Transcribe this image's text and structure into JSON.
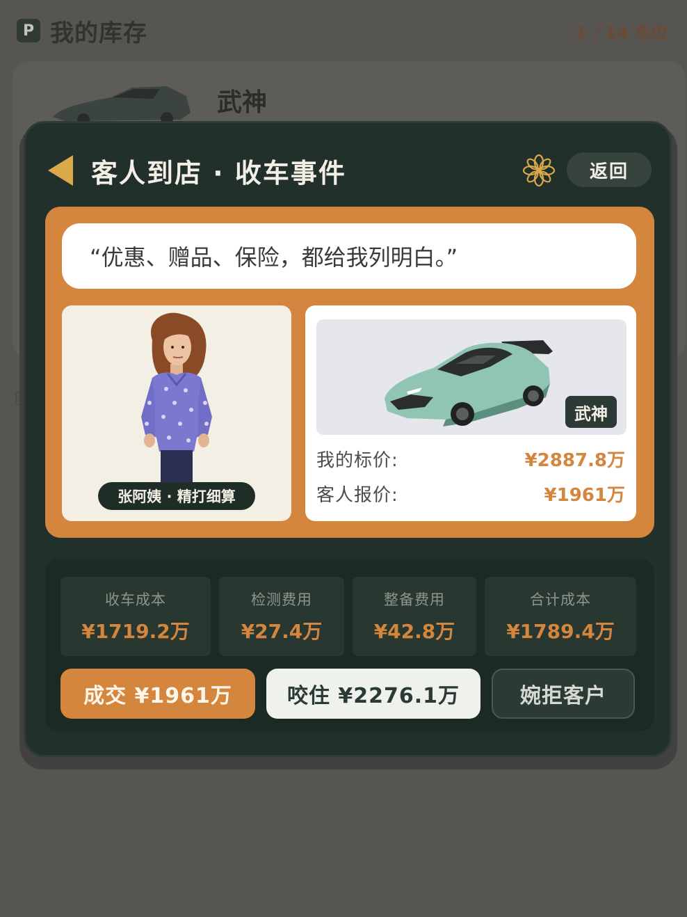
{
  "background": {
    "page_badge": "P",
    "page_title": "我的库存",
    "slots": "1 / 14 车位",
    "car_name": "武神",
    "side_text": "压"
  },
  "modal": {
    "title": "客人到店 · 收车事件",
    "return_label": "返回",
    "quote": "“优惠、赠品、保险，都给我列明白。”",
    "customer": {
      "tag": "张阿姨 · 精打细算"
    },
    "car": {
      "badge": "武神",
      "my_price_label": "我的标价:",
      "my_price_value": "¥2887.8万",
      "customer_offer_label": "客人报价:",
      "customer_offer_value": "¥1961万"
    },
    "costs": [
      {
        "label": "收车成本",
        "value": "¥1719.2万"
      },
      {
        "label": "检测费用",
        "value": "¥27.4万"
      },
      {
        "label": "整备费用",
        "value": "¥42.8万"
      },
      {
        "label": "合计成本",
        "value": "¥1789.4万"
      }
    ],
    "actions": {
      "deal": "成交 ¥1961万",
      "counter": "咬住 ¥2276.1万",
      "reject": "婉拒客户"
    }
  },
  "colors": {
    "accent": "#d4853e",
    "panel_dark": "#21302a",
    "gold": "#d9a94a"
  },
  "icons": [
    "back-arrow-icon",
    "flower-icon",
    "parking-icon"
  ]
}
